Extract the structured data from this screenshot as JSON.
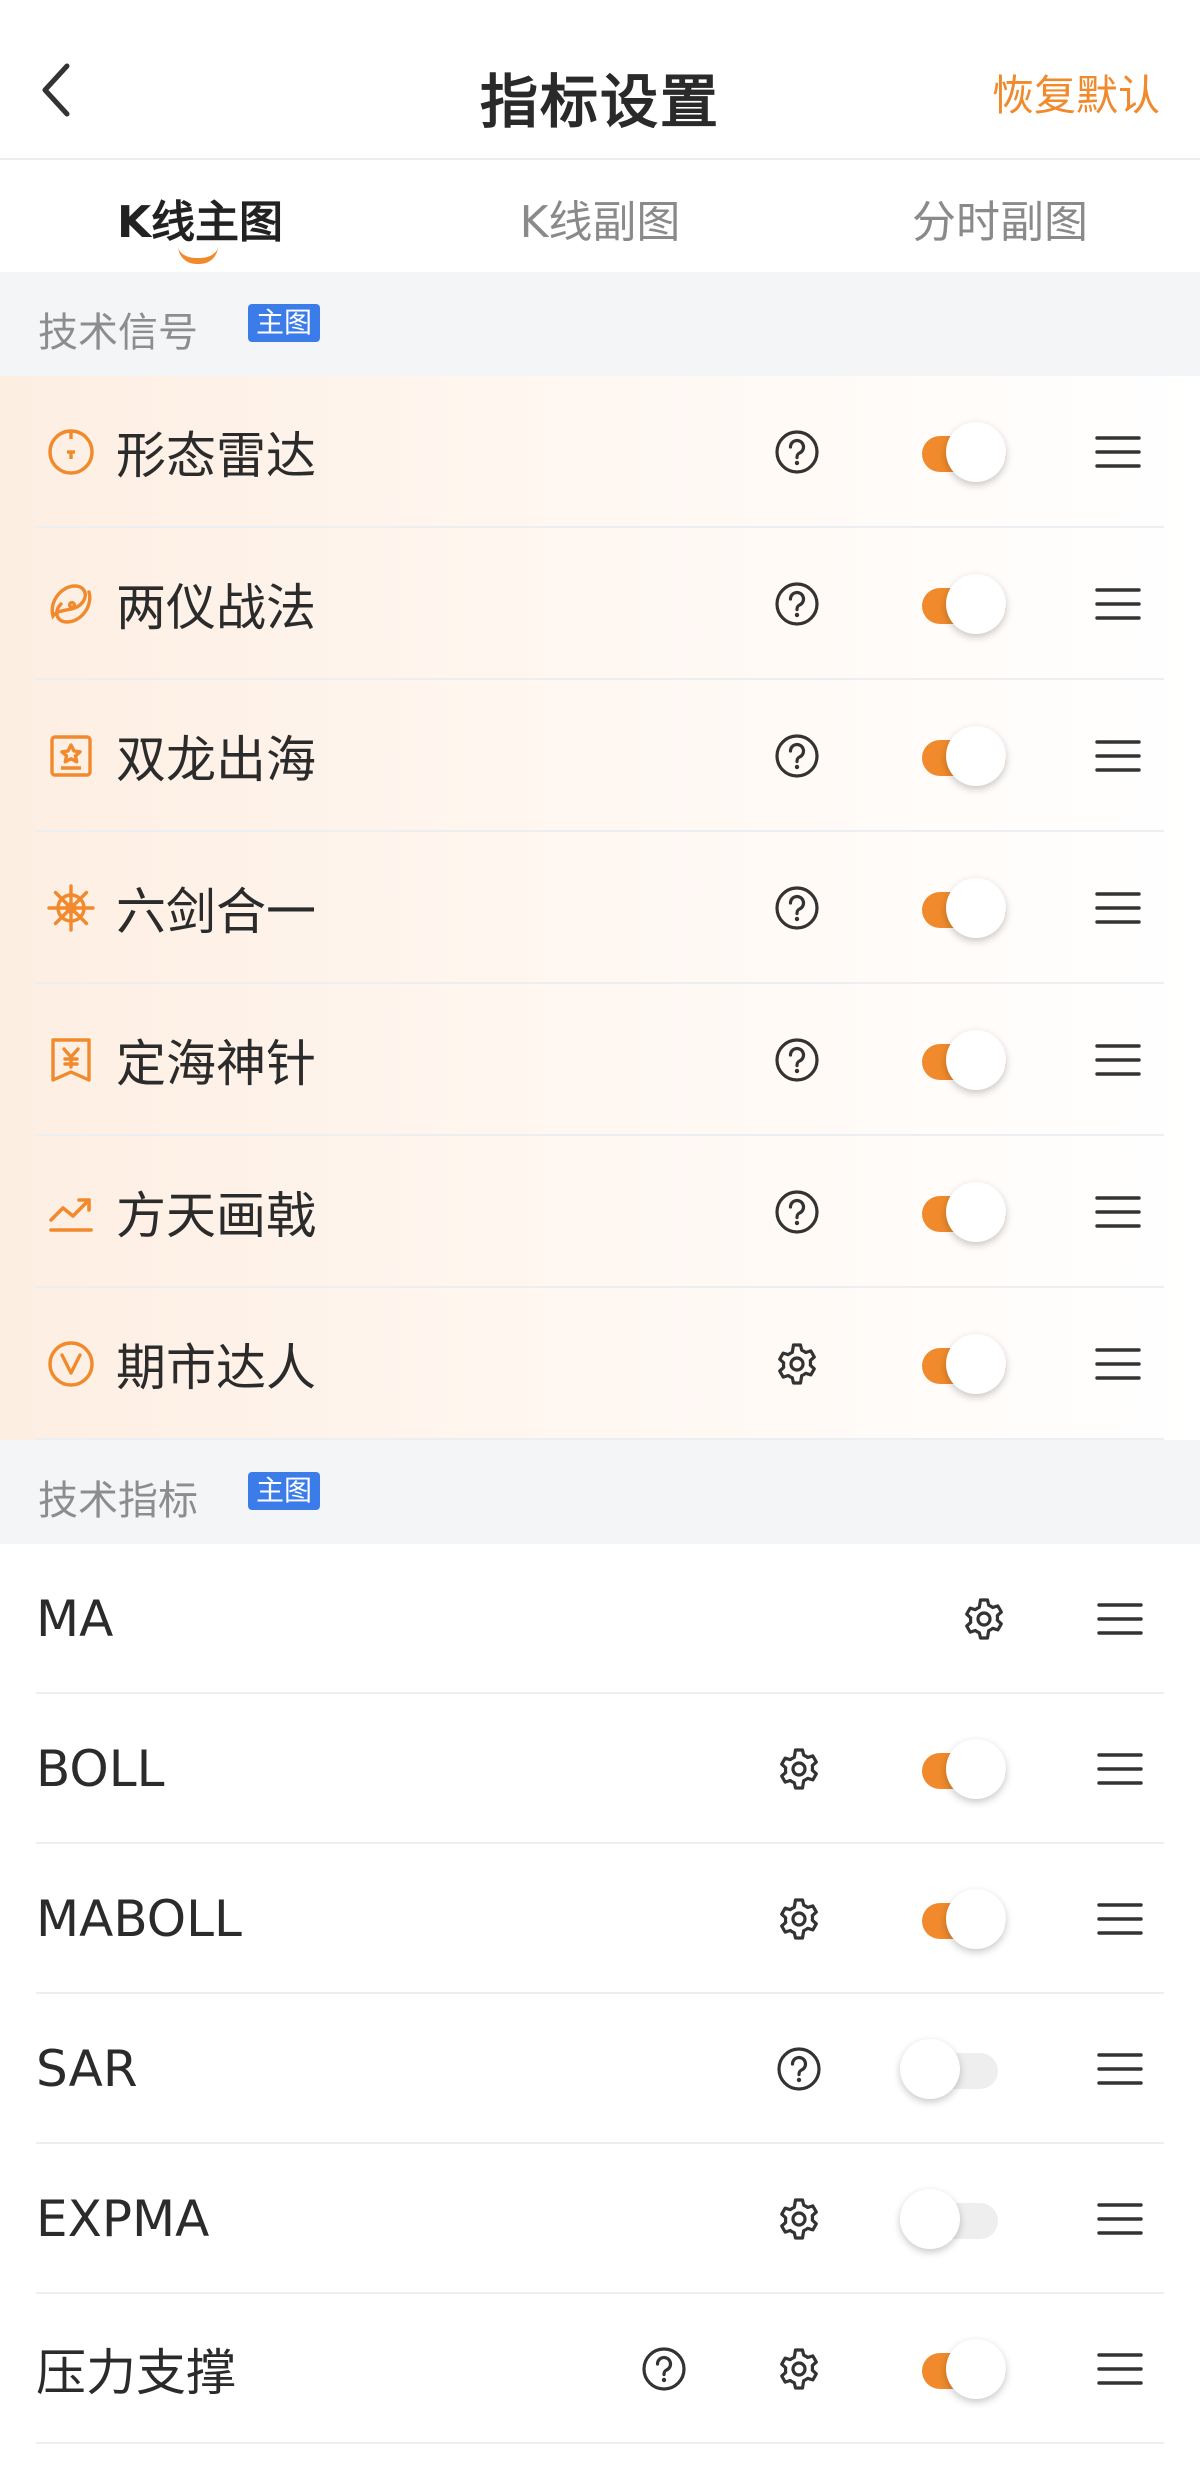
{
  "header": {
    "title": "指标设置",
    "restore_label": "恢复默认"
  },
  "tabs": [
    {
      "label": "K线主图",
      "active": true
    },
    {
      "label": "K线副图",
      "active": false
    },
    {
      "label": "分时副图",
      "active": false
    }
  ],
  "colors": {
    "accent": "#f08a2c",
    "badge": "#3c7ce8",
    "section_bg": "#f4f5f7"
  },
  "signals": {
    "title": "技术信号",
    "badge": "主图",
    "items": [
      {
        "label": "形态雷达",
        "icon": "radar-icon",
        "action": "help-icon",
        "enabled": true
      },
      {
        "label": "两仪战法",
        "icon": "yinyang-icon",
        "action": "help-icon",
        "enabled": true
      },
      {
        "label": "双龙出海",
        "icon": "dragon-badge-icon",
        "action": "help-icon",
        "enabled": true
      },
      {
        "label": "六剑合一",
        "icon": "helm-wheel-icon",
        "action": "help-icon",
        "enabled": true
      },
      {
        "label": "定海神针",
        "icon": "yuan-flag-icon",
        "action": "help-icon",
        "enabled": true
      },
      {
        "label": "方天画戟",
        "icon": "trend-icon",
        "action": "help-icon",
        "enabled": true
      },
      {
        "label": "期市达人",
        "icon": "v-circle-icon",
        "action": "gear-icon",
        "enabled": true
      }
    ]
  },
  "indicators": {
    "title": "技术指标",
    "badge": "主图",
    "items": [
      {
        "label": "MA",
        "actions": [
          "gear-icon"
        ],
        "toggle": null
      },
      {
        "label": "BOLL",
        "actions": [
          "gear-icon"
        ],
        "enabled": true
      },
      {
        "label": "MABOLL",
        "actions": [
          "gear-icon"
        ],
        "enabled": true
      },
      {
        "label": "SAR",
        "actions": [
          "help-icon"
        ],
        "enabled": false
      },
      {
        "label": "EXPMA",
        "actions": [
          "gear-icon"
        ],
        "enabled": false
      },
      {
        "label": "压力支撑",
        "actions": [
          "help-icon",
          "gear-icon"
        ],
        "enabled": true
      }
    ]
  }
}
